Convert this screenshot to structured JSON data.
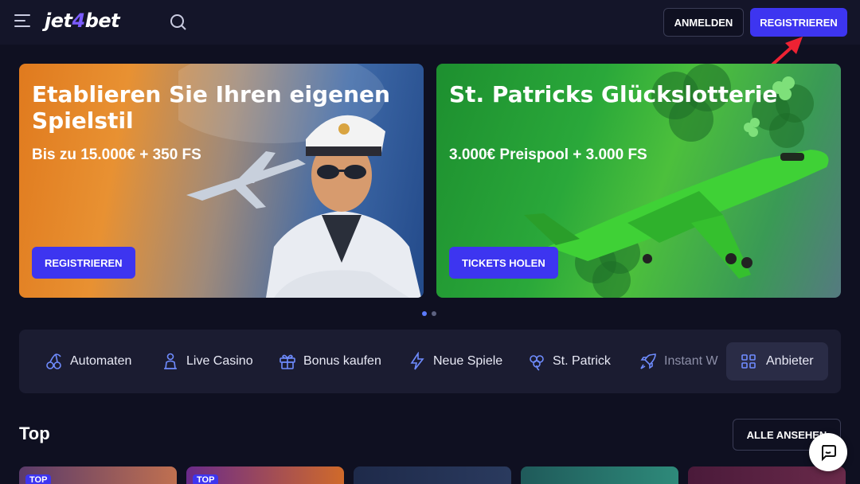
{
  "header": {
    "logo_main": "jet",
    "logo_four": "4",
    "logo_bet": "bet",
    "login_label": "ANMELDEN",
    "register_label": "REGISTRIEREN"
  },
  "banners": [
    {
      "title": "Etablieren Sie Ihren eigenen Spielstil",
      "subtitle": "Bis zu 15.000€ + 350 FS",
      "button": "REGISTRIEREN"
    },
    {
      "title": "St. Patricks Glückslotterie",
      "subtitle": "3.000€ Preispool + 3.000 FS",
      "button": "TICKETS HOLEN"
    }
  ],
  "carousel": {
    "active_index": 0,
    "count": 2
  },
  "categories": [
    {
      "label": "Automaten",
      "icon": "cherries-icon"
    },
    {
      "label": "Live Casino",
      "icon": "dealer-icon"
    },
    {
      "label": "Bonus kaufen",
      "icon": "gift-icon"
    },
    {
      "label": "Neue Spiele",
      "icon": "lightning-icon"
    },
    {
      "label": "St. Patrick",
      "icon": "clover-icon"
    },
    {
      "label": "Instant W",
      "icon": "rocket-icon"
    }
  ],
  "provider_label": "Anbieter",
  "top_section": {
    "title": "Top",
    "view_all": "ALLE ANSEHEN",
    "tag": "TOP"
  },
  "colors": {
    "accent": "#3d35f0",
    "background": "#0f1021",
    "panel": "#1b1c31"
  }
}
